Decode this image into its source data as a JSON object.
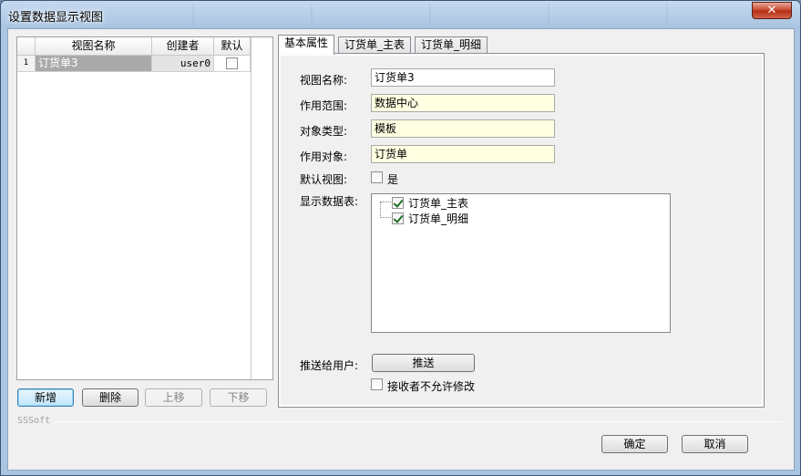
{
  "window": {
    "title": "设置数据显示视图",
    "close_label": "✕"
  },
  "grid": {
    "columns": [
      "视图名称",
      "创建者",
      "默认"
    ],
    "rows": [
      {
        "num": "1",
        "name": "订货单3",
        "creator": "user0",
        "default": false
      }
    ]
  },
  "left_buttons": {
    "add": "新增",
    "delete": "删除",
    "up": "上移",
    "down": "下移"
  },
  "tabs": [
    "基本属性",
    "订货单_主表",
    "订货单_明细"
  ],
  "form": {
    "view_name_label": "视图名称:",
    "view_name_value": "订货单3",
    "scope_label": "作用范围:",
    "scope_value": "数据中心",
    "object_type_label": "对象类型:",
    "object_type_value": "模板",
    "target_object_label": "作用对象:",
    "target_object_value": "订货单",
    "default_view_label": "默认视图:",
    "default_view_check_label": "是",
    "default_view_checked": false,
    "tables_label": "显示数据表:",
    "tables": [
      {
        "label": "订货单_主表",
        "checked": true
      },
      {
        "label": "订货单_明细",
        "checked": true
      }
    ],
    "push_label": "推送给用户:",
    "push_button": "推送",
    "no_modify_label": "接收者不允许修改",
    "no_modify_checked": false
  },
  "footer": {
    "brand": "SSSoft",
    "ok": "确定",
    "cancel": "取消"
  },
  "colors": {
    "selected_row": "#a9a9a9",
    "readonly_field": "#ffffe1",
    "close_button": "#c7432b"
  }
}
